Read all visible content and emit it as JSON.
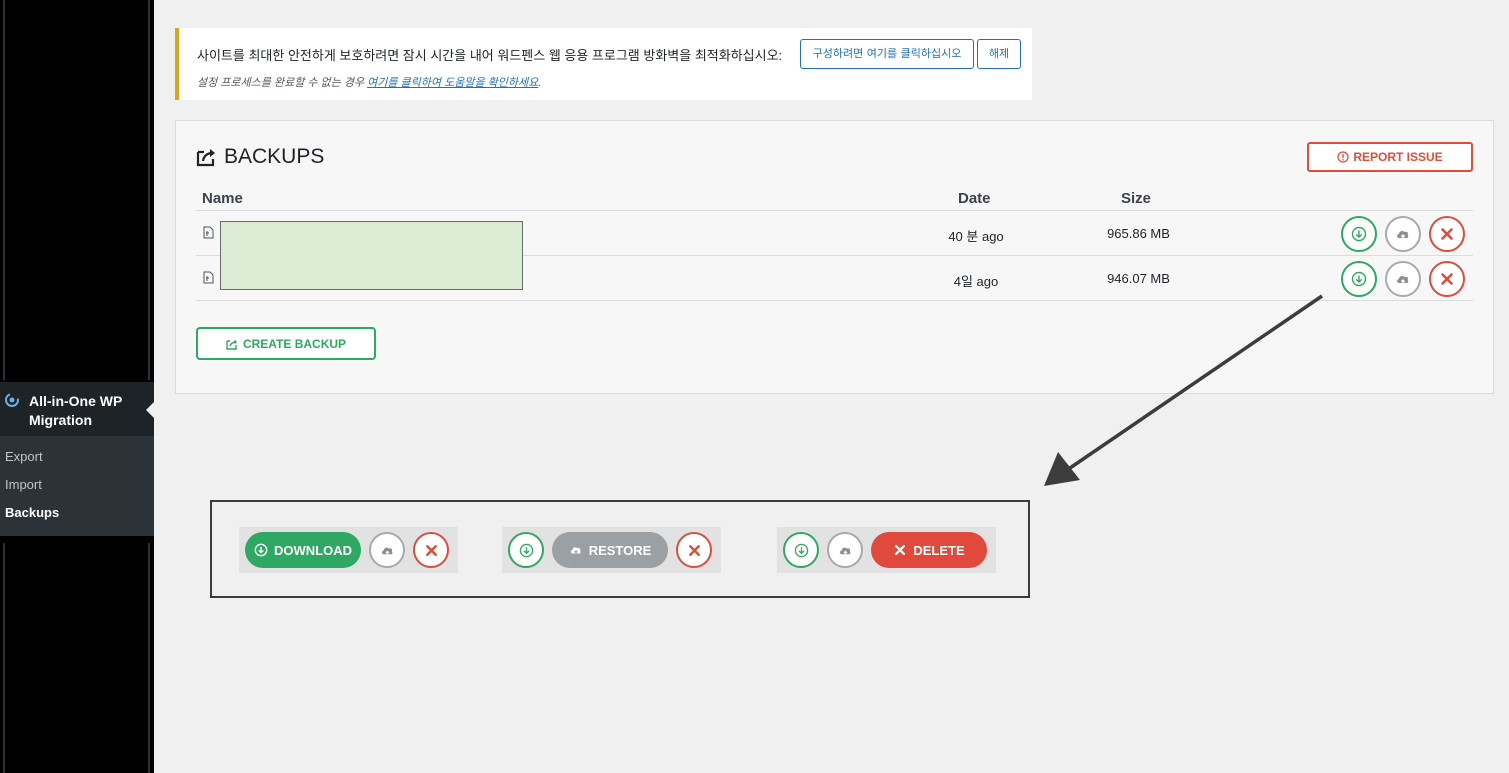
{
  "sidebar": {
    "active_label": "All-in-One WP Migration",
    "items": [
      {
        "label": "Export",
        "current": false
      },
      {
        "label": "Import",
        "current": false
      },
      {
        "label": "Backups",
        "current": true
      }
    ]
  },
  "notice": {
    "text": "사이트를 최대한 안전하게 보호하려면 잠시 시간을 내어 워드펜스 웹 응용 프로그램 방화벽을 최적화하십시오:",
    "configure_button": "구성하려면 여기를 클릭하십시오",
    "dismiss_button": "해제",
    "help_prefix": "설정 프로세스를 완료할 수 없는 경우 ",
    "help_link": "여기를 클릭하여 도움말을 확인하세요",
    "help_suffix": "."
  },
  "backups": {
    "title": "BACKUPS",
    "report_button": "REPORT ISSUE",
    "columns": {
      "name": "Name",
      "date": "Date",
      "size": "Size"
    },
    "rows": [
      {
        "date": "40 분 ago",
        "size": "965.86 MB"
      },
      {
        "date": "4일 ago",
        "size": "946.07 MB"
      }
    ],
    "create_button": "CREATE BACKUP"
  },
  "illustration": {
    "download_label": "DOWNLOAD",
    "restore_label": "RESTORE",
    "delete_label": "DELETE"
  },
  "colors": {
    "green": "#2ea862",
    "red": "#e0493b",
    "grey": "#9aa0a3",
    "notice_accent": "#dba617",
    "link": "#2271b1"
  }
}
